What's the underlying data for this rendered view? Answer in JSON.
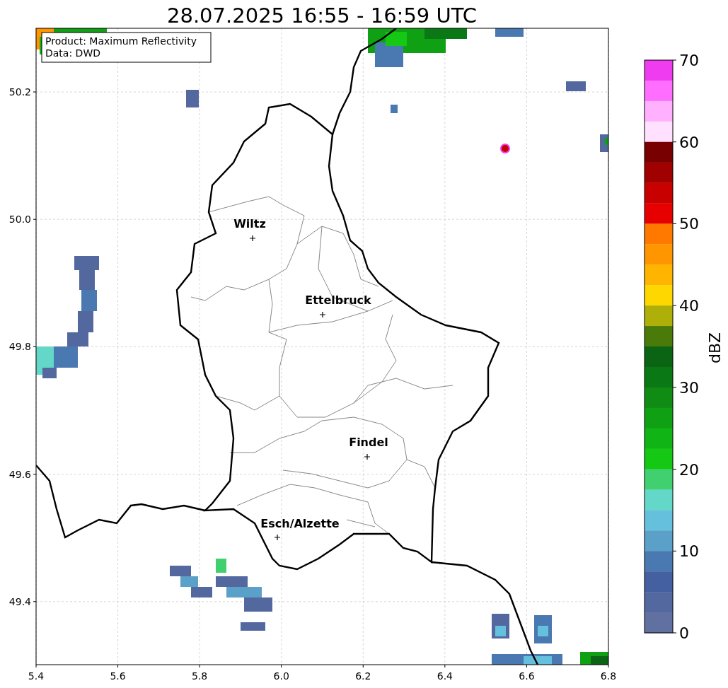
{
  "title": "28.07.2025 16:55 - 16:59 UTC",
  "info_box": {
    "lines": [
      "Product: Maximum Reflectivity",
      "Data: DWD"
    ]
  },
  "cities": [
    {
      "name": "Wiltz"
    },
    {
      "name": "Ettelbruck"
    },
    {
      "name": "Findel"
    },
    {
      "name": "Esch/Alzette"
    }
  ],
  "x_axis": {
    "ticks": [
      "5.4",
      "5.6",
      "5.8",
      "6.0",
      "6.2",
      "6.4",
      "6.6",
      "6.8"
    ]
  },
  "y_axis": {
    "ticks": [
      "50.2",
      "50.0",
      "49.8",
      "49.6",
      "49.4"
    ]
  },
  "colorbar": {
    "label": "dBZ",
    "ticks": [
      "70",
      "60",
      "50",
      "40",
      "30",
      "20",
      "10",
      "0"
    ],
    "steps": [
      {
        "color": "#f03cf0"
      },
      {
        "color": "#ff6eff"
      },
      {
        "color": "#ffb0ff"
      },
      {
        "color": "#ffe0ff"
      },
      {
        "color": "#780000"
      },
      {
        "color": "#a00000"
      },
      {
        "color": "#c80000"
      },
      {
        "color": "#e60000"
      },
      {
        "color": "#ff7800"
      },
      {
        "color": "#ff9600"
      },
      {
        "color": "#ffb400"
      },
      {
        "color": "#ffd700"
      },
      {
        "color": "#afaf0a"
      },
      {
        "color": "#4a7a0a"
      },
      {
        "color": "#0a6414"
      },
      {
        "color": "#0a7814"
      },
      {
        "color": "#108c14"
      },
      {
        "color": "#10a014"
      },
      {
        "color": "#10b414"
      },
      {
        "color": "#14c814"
      },
      {
        "color": "#40d070"
      },
      {
        "color": "#64d8c8"
      },
      {
        "color": "#64c0dc"
      },
      {
        "color": "#5aa0c8"
      },
      {
        "color": "#4a78b0"
      },
      {
        "color": "#4560a0"
      },
      {
        "color": "#5468a0"
      },
      {
        "color": "#6070a0"
      }
    ]
  }
}
